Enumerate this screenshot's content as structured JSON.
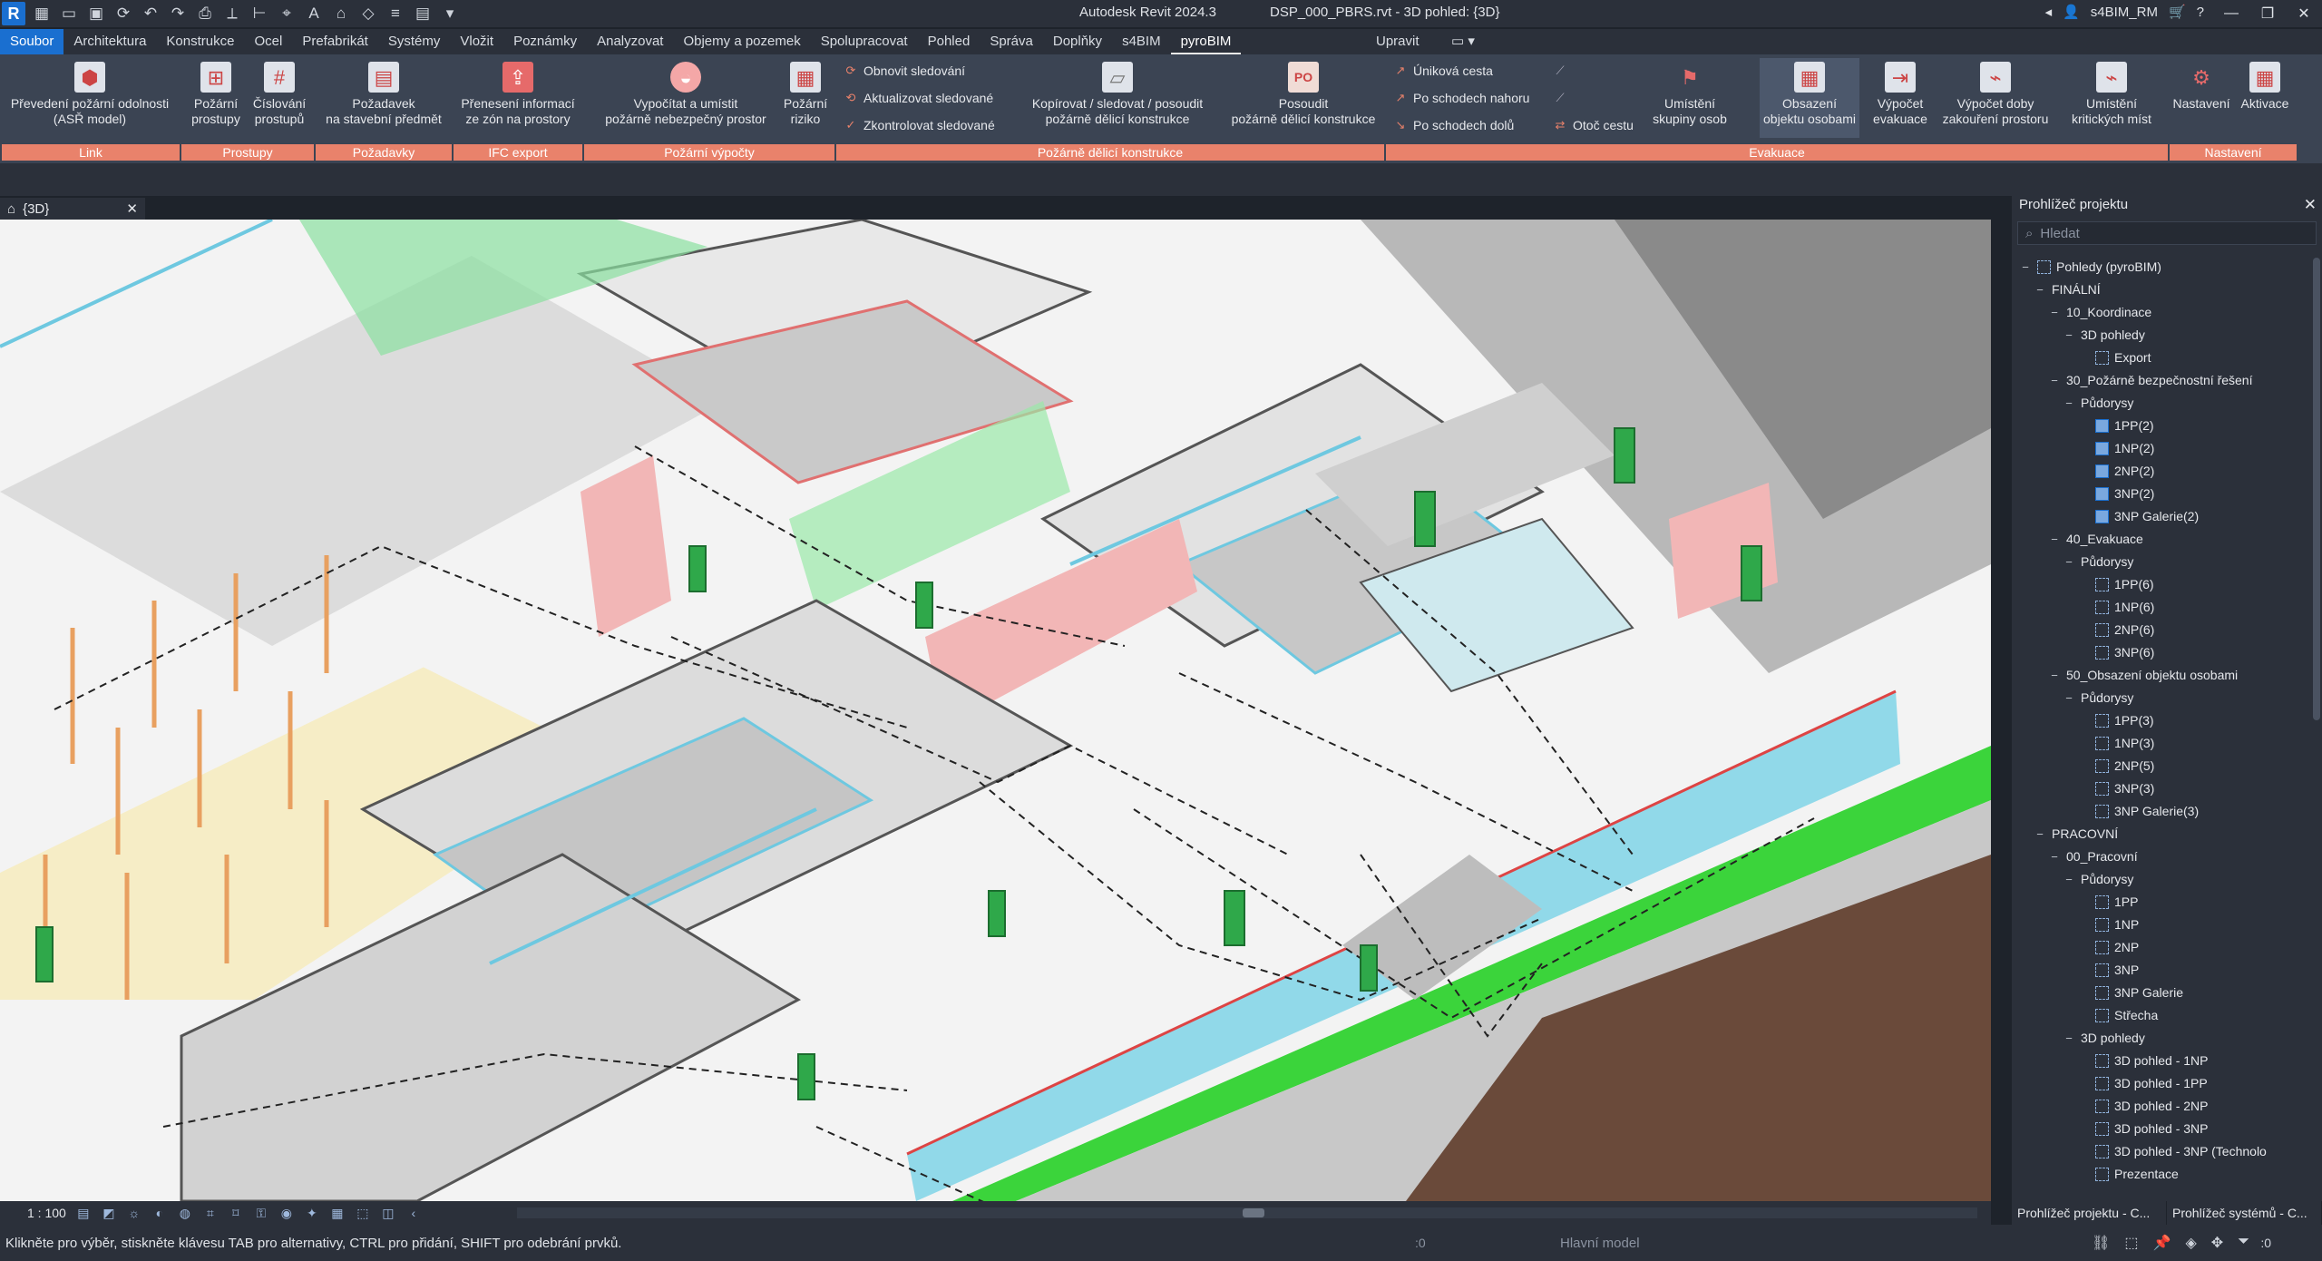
{
  "window": {
    "app_title": "Autodesk Revit 2024.3",
    "file_title": "DSP_000_PBRS.rvt - 3D pohled: {3D}",
    "user": "s4BIM_RM",
    "logo": "R"
  },
  "tabs": {
    "items": [
      "Soubor",
      "Architektura",
      "Konstrukce",
      "Ocel",
      "Prefabrikát",
      "Systémy",
      "Vložit",
      "Poznámky",
      "Analyzovat",
      "Objemy a pozemek",
      "Spolupracovat",
      "Pohled",
      "Správa",
      "Doplňky",
      "s4BIM",
      "pyroBIM"
    ],
    "upravit": "Upravit"
  },
  "ribbon": {
    "buttons": [
      {
        "label1": "Převedení požární odolnosti",
        "label2": "(ASŘ model)"
      },
      {
        "label1": "Požární",
        "label2": "prostupy"
      },
      {
        "label1": "Číslování",
        "label2": "prostupů"
      },
      {
        "label1": "Požadavek",
        "label2": "na stavební předmět"
      },
      {
        "label1": "Přenesení informací",
        "label2": "ze zón na prostory"
      },
      {
        "label1": "Vypočítat a umístit",
        "label2": "požárně nebezpečný prostor"
      },
      {
        "label1": "Požární",
        "label2": "riziko"
      },
      {
        "label1": "Kopírovat / sledovat / posoudit",
        "label2": "požárně dělicí konstrukce"
      },
      {
        "label1": "Posoudit",
        "label2": "požárně dělicí konstrukce"
      },
      {
        "label1": "Umístění",
        "label2": "skupiny osob"
      },
      {
        "label1": "Obsazení",
        "label2": "objektu osobami"
      },
      {
        "label1": "Výpočet",
        "label2": "evakuace"
      },
      {
        "label1": "Výpočet doby",
        "label2": "zakouření prostoru"
      },
      {
        "label1": "Umístění",
        "label2": "kritických míst"
      },
      {
        "label1": "Nastavení",
        "label2": ""
      },
      {
        "label1": "Aktivace",
        "label2": ""
      }
    ],
    "small": {
      "obnovit": "Obnovit sledování",
      "aktualizovat": "Aktualizovat sledované",
      "zkontrolovat": "Zkontrolovat sledované",
      "unikova": "Úniková cesta",
      "nahoru": "Po schodech nahoru",
      "dolu": "Po schodech dolů",
      "otoc": "Otoč cestu"
    },
    "groups": [
      "Link",
      "Prostupy",
      "Požadavky",
      "IFC export",
      "Požární výpočty",
      "Požárně dělicí konstrukce",
      "Evakuace",
      "Nastavení"
    ]
  },
  "view": {
    "tab_label": "{3D}",
    "scale": "1 : 100"
  },
  "browser": {
    "title": "Prohlížeč projektu",
    "search_placeholder": "Hledat",
    "tree": [
      {
        "label": "Pohledy (pyroBIM)",
        "level": 0,
        "tog": "−",
        "icon": "root"
      },
      {
        "label": "FINÁLNÍ",
        "level": 1,
        "tog": "−"
      },
      {
        "label": "10_Koordinace",
        "level": 2,
        "tog": "−"
      },
      {
        "label": "3D pohledy",
        "level": 3,
        "tog": "−"
      },
      {
        "label": "Export",
        "level": 4,
        "icon": "view"
      },
      {
        "label": "30_Požárně bezpečnostní řešení",
        "level": 2,
        "tog": "−"
      },
      {
        "label": "Půdorysy",
        "level": 3,
        "tog": "−"
      },
      {
        "label": "1PP(2)",
        "level": 4,
        "icon": "solid"
      },
      {
        "label": "1NP(2)",
        "level": 4,
        "icon": "solid"
      },
      {
        "label": "2NP(2)",
        "level": 4,
        "icon": "solid"
      },
      {
        "label": "3NP(2)",
        "level": 4,
        "icon": "solid"
      },
      {
        "label": "3NP Galerie(2)",
        "level": 4,
        "icon": "solid"
      },
      {
        "label": "40_Evakuace",
        "level": 2,
        "tog": "−"
      },
      {
        "label": "Půdorysy",
        "level": 3,
        "tog": "−"
      },
      {
        "label": "1PP(6)",
        "level": 4,
        "icon": "view"
      },
      {
        "label": "1NP(6)",
        "level": 4,
        "icon": "view"
      },
      {
        "label": "2NP(6)",
        "level": 4,
        "icon": "view"
      },
      {
        "label": "3NP(6)",
        "level": 4,
        "icon": "view"
      },
      {
        "label": "50_Obsazení objektu osobami",
        "level": 2,
        "tog": "−"
      },
      {
        "label": "Půdorysy",
        "level": 3,
        "tog": "−"
      },
      {
        "label": "1PP(3)",
        "level": 4,
        "icon": "view"
      },
      {
        "label": "1NP(3)",
        "level": 4,
        "icon": "view"
      },
      {
        "label": "2NP(5)",
        "level": 4,
        "icon": "view"
      },
      {
        "label": "3NP(3)",
        "level": 4,
        "icon": "view"
      },
      {
        "label": "3NP Galerie(3)",
        "level": 4,
        "icon": "view"
      },
      {
        "label": "PRACOVNÍ",
        "level": 1,
        "tog": "−"
      },
      {
        "label": "00_Pracovní",
        "level": 2,
        "tog": "−"
      },
      {
        "label": "Půdorysy",
        "level": 3,
        "tog": "−"
      },
      {
        "label": "1PP",
        "level": 4,
        "icon": "view"
      },
      {
        "label": "1NP",
        "level": 4,
        "icon": "view"
      },
      {
        "label": "2NP",
        "level": 4,
        "icon": "view"
      },
      {
        "label": "3NP",
        "level": 4,
        "icon": "view"
      },
      {
        "label": "3NP Galerie",
        "level": 4,
        "icon": "view"
      },
      {
        "label": "Střecha",
        "level": 4,
        "icon": "view"
      },
      {
        "label": "3D pohledy",
        "level": 3,
        "tog": "−"
      },
      {
        "label": "3D pohled - 1NP",
        "level": 4,
        "icon": "view"
      },
      {
        "label": "3D pohled - 1PP",
        "level": 4,
        "icon": "view"
      },
      {
        "label": "3D pohled - 2NP",
        "level": 4,
        "icon": "view"
      },
      {
        "label": "3D pohled - 3NP",
        "level": 4,
        "icon": "view"
      },
      {
        "label": "3D pohled - 3NP (Technolo",
        "level": 4,
        "icon": "view"
      },
      {
        "label": "Prezentace",
        "level": 4,
        "icon": "view"
      }
    ],
    "bottom_tabs": [
      "Prohlížeč projektu - C...",
      "Prohlížeč systémů - C..."
    ]
  },
  "status": {
    "text": "Klikněte pro výběr, stiskněte klávesu TAB pro alternativy, CTRL pro přidání, SHIFT pro odebrání prvků.",
    "model": "Hlavní model",
    "zero": ":0",
    "filter_zero": ":0"
  },
  "colors": {
    "accent": "#1a6fd0",
    "group_bar": "#e9826b",
    "ribbon_bg": "#3b4453",
    "chrome_bg": "#2b303a"
  }
}
